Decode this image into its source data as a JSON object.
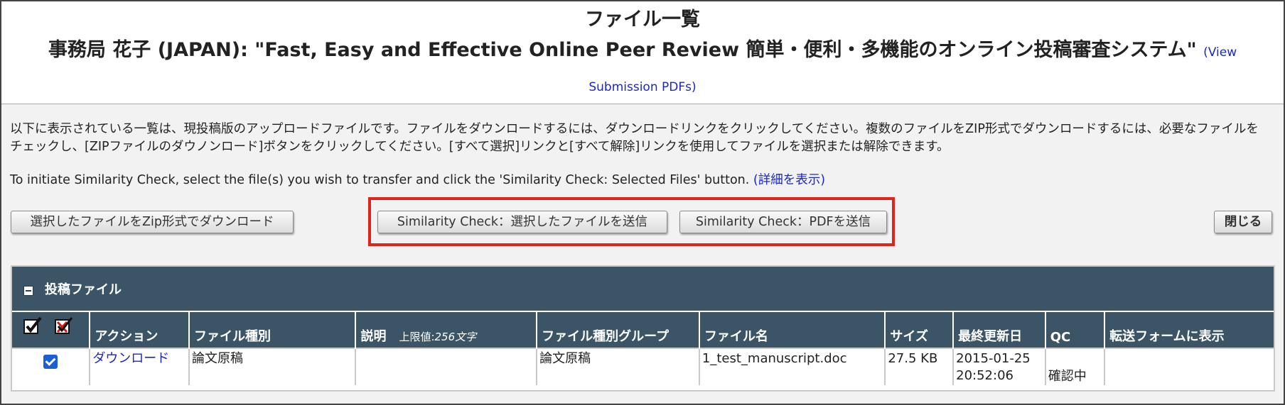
{
  "header": {
    "title": "ファイル一覧",
    "subtitle": "事務局 花子 (JAPAN): \"Fast, Easy and Effective Online Peer Review 簡単・便利・多機能のオンライン投稿審査システム\"",
    "view_pdfs_link": "(View Submission PDFs)"
  },
  "description": {
    "ja": "以下に表示されている一覧は、現投稿版のアップロードファイルです。ファイルをダウンロードするには、ダウンロードリンクをクリックしてください。複数のファイルをZIP形式でダウンロードするには、必要なファイルをチェックし、[ZIPファイルのダウノンロード]ボタンをクリックしてください。[すべて選択]リンクと[すべて解除]リンクを使用してファイルを選択または解除できます。",
    "en": "To initiate Similarity Check, select the file(s) you wish to transfer and click the 'Similarity Check: Selected Files' button.",
    "details_link": "(詳細を表示)"
  },
  "toolbar": {
    "zip_download": "選択したファイルをZip形式でダウンロード",
    "similarity_selected": "Similarity Check：選択したファイルを送信",
    "similarity_pdf": "Similarity Check：PDFを送信",
    "close": "閉じる"
  },
  "section": {
    "title": "投稿ファイル"
  },
  "table": {
    "columns": {
      "action": "アクション",
      "file_type": "ファイル種別",
      "description": "説明",
      "description_limit_prefix": "上限値:",
      "description_limit_value": "256文字",
      "file_type_group": "ファイル種別グループ",
      "file_name": "ファイル名",
      "size": "サイズ",
      "last_updated": "最終更新日",
      "qc": "QC",
      "show_in_transfer": "転送フォームに表示"
    },
    "rows": [
      {
        "checked": true,
        "action": "ダウンロード",
        "file_type": "論文原稿",
        "description": "",
        "file_type_group": "論文原稿",
        "file_name": "1_test_manuscript.doc",
        "size": "27.5 KB",
        "date": "2015-01-25",
        "time": "20:52:06",
        "qc": "確認中",
        "show_in_transfer": ""
      }
    ]
  },
  "colors": {
    "header_bar": "#3c5566",
    "link": "#1a27c9",
    "highlight": "#e2231a"
  }
}
